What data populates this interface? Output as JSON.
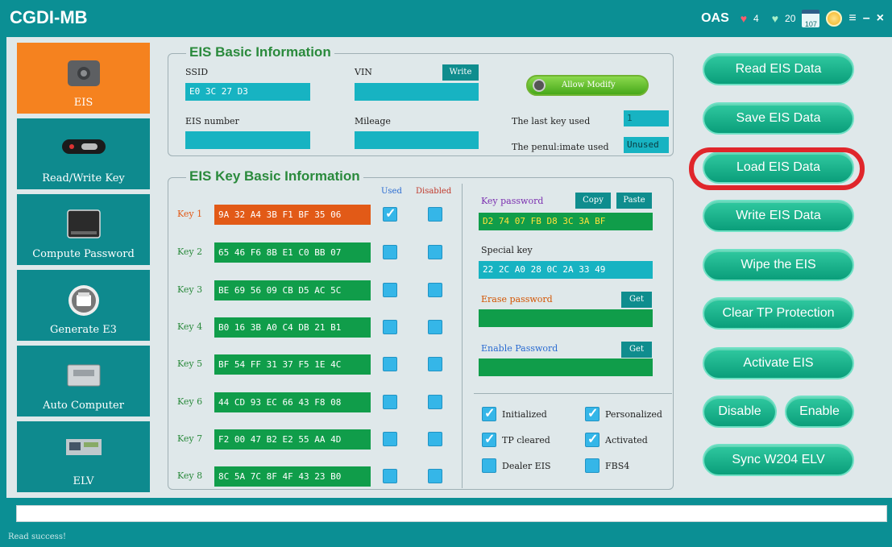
{
  "app": {
    "title": "CGDI-MB"
  },
  "titlebar": {
    "oas": "OAS",
    "hearts": "4",
    "gems": "20",
    "calendar": "107"
  },
  "nav": [
    {
      "label": "EIS",
      "icon": "eis-module-icon",
      "active": true
    },
    {
      "label": "Read/Write Key",
      "icon": "car-key-icon",
      "active": false
    },
    {
      "label": "Compute Password",
      "icon": "device-icon",
      "active": false
    },
    {
      "label": "Generate E3",
      "icon": "printer-icon",
      "active": false
    },
    {
      "label": "Auto Computer",
      "icon": "ecu-icon",
      "active": false
    },
    {
      "label": "ELV",
      "icon": "elv-board-icon",
      "active": false
    }
  ],
  "basic": {
    "title": "EIS Basic Information",
    "ssid_label": "SSID",
    "ssid_value": "E0 3C 27 D3",
    "vin_label": "VIN",
    "vin_value": "",
    "write_btn": "Write",
    "allow_modify": "Allow Modify",
    "eis_number_label": "EIS number",
    "eis_number_value": "",
    "mileage_label": "Mileage",
    "mileage_value": "",
    "last_key_label": "The last key used",
    "last_key_value": "1",
    "penultimate_label": "The penul:imate used",
    "penultimate_value": "Unused"
  },
  "keys": {
    "title": "EIS Key Basic Information",
    "used_header": "Used",
    "disabled_header": "Disabled",
    "rows": [
      {
        "label": "Key 1",
        "value": "9A 32 A4 3B F1 BF 35 06",
        "used": true,
        "disabled": false
      },
      {
        "label": "Key 2",
        "value": "65 46 F6 8B E1 C0 BB 07",
        "used": false,
        "disabled": false
      },
      {
        "label": "Key 3",
        "value": "BE 69 56 09 CB D5 AC 5C",
        "used": false,
        "disabled": false
      },
      {
        "label": "Key 4",
        "value": "B0 16 3B A0 C4 DB 21 B1",
        "used": false,
        "disabled": false
      },
      {
        "label": "Key 5",
        "value": "BF 54 FF 31 37 F5 1E 4C",
        "used": false,
        "disabled": false
      },
      {
        "label": "Key 6",
        "value": "44 CD 93 EC 66 43 F8 08",
        "used": false,
        "disabled": false
      },
      {
        "label": "Key 7",
        "value": "F2 00 47 B2 E2 55 AA 4D",
        "used": false,
        "disabled": false
      },
      {
        "label": "Key 8",
        "value": "8C 5A 7C 8F 4F 43 23 B0",
        "used": false,
        "disabled": false
      }
    ],
    "key_password_label": "Key password",
    "copy_btn": "Copy",
    "paste_btn": "Paste",
    "key_password_value": "D2 74 07 FB D8 3C 3A BF",
    "special_key_label": "Special key",
    "special_key_value": "22 2C A0 28 0C 2A 33 49",
    "erase_password_label": "Erase password",
    "erase_get_btn": "Get",
    "erase_password_value": "",
    "enable_password_label": "Enable Password",
    "enable_get_btn": "Get",
    "enable_password_value": "",
    "status": [
      {
        "label": "Initialized",
        "checked": true
      },
      {
        "label": "Personalized",
        "checked": true
      },
      {
        "label": "TP cleared",
        "checked": true
      },
      {
        "label": "Activated",
        "checked": true
      },
      {
        "label": "Dealer EIS",
        "checked": false
      },
      {
        "label": "FBS4",
        "checked": false
      }
    ]
  },
  "actions": {
    "read": "Read  EIS Data",
    "save": "Save EIS Data",
    "load": "Load EIS Data",
    "write": "Write EIS Data",
    "wipe": "Wipe the EIS",
    "clear_tp": "Clear TP Protection",
    "activate": "Activate EIS",
    "disable": "Disable",
    "enable": "Enable",
    "sync": "Sync W204 ELV"
  },
  "statusbar": {
    "message": "Read success!"
  },
  "colors": {
    "accent": "#0b8f94",
    "active_nav": "#f5821f",
    "highlight": "#e0262b"
  }
}
